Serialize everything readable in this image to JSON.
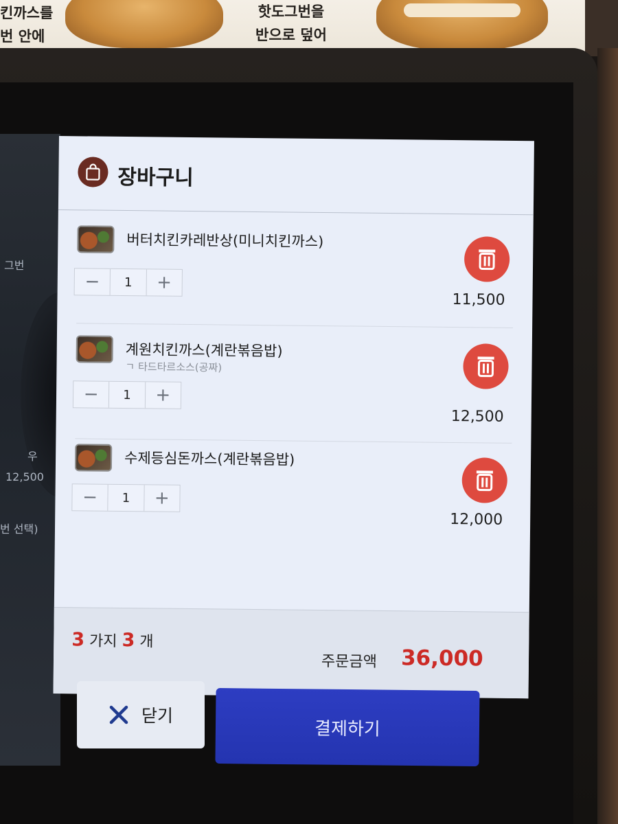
{
  "poster": {
    "left_lines": [
      "킨까스를",
      "번 안에"
    ],
    "right_lines": [
      "핫도그번을",
      "반으로 덮어"
    ]
  },
  "underlying_menu": {
    "fragment1": "그번",
    "fragment2": "우",
    "price": "12,500",
    "fragment3": "번 선택)"
  },
  "cart": {
    "title": "장바구니",
    "items": [
      {
        "name": "버터치킨카레반상(미니치킨까스)",
        "option": "",
        "qty": "1",
        "price": "11,500"
      },
      {
        "name": "계원치킨까스(계란볶음밥)",
        "option": "ㄱ 타드타르소스(공짜)",
        "qty": "1",
        "price": "12,500"
      },
      {
        "name": "수제등심돈까스(계란볶음밥)",
        "option": "",
        "qty": "1",
        "price": "12,000"
      }
    ],
    "summary": {
      "kinds_count": "3",
      "kinds_label": "가지",
      "items_count": "3",
      "items_label": "개",
      "total_label": "주문금액",
      "total_value": "36,000"
    }
  },
  "buttons": {
    "close_label": "닫기",
    "pay_label": "결제하기"
  },
  "colors": {
    "accent_red": "#de4a3f",
    "pay_blue": "#2434b0",
    "cart_icon_brown": "#6a2b22"
  },
  "icons": {
    "cart": "shopping-bag-icon",
    "delete": "trash-icon",
    "close": "close-x-icon"
  }
}
